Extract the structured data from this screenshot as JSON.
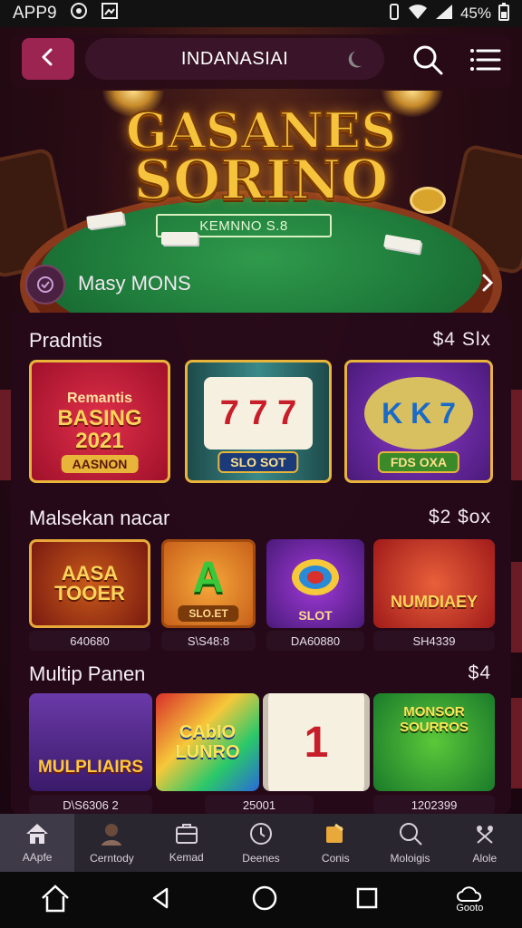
{
  "status": {
    "left_text": "APP9",
    "battery": "45%"
  },
  "header": {
    "title": "INDANASIAI"
  },
  "hero": {
    "title_line1": "GASANES",
    "title_line2": "SORINO",
    "felt_text": "KEMNNO  S.8"
  },
  "promo": {
    "text": "Masy MONS"
  },
  "sections": [
    {
      "title": "Pradntis",
      "right": "$4 Slx",
      "tiles": [
        {
          "line1": "Remantis",
          "line2": "BASING 2021",
          "label": "AASNON"
        },
        {
          "line1": "7 7 7",
          "line2": "",
          "label": "SLO SOT"
        },
        {
          "line1": "K K 7",
          "line2": "",
          "label": "FDS OXA"
        }
      ]
    },
    {
      "title": "Malsekan nacar",
      "right": "$2 $ox",
      "tiles": [
        {
          "line1": "AASA TOOER",
          "label": ""
        },
        {
          "line1": "A",
          "label": "SLO.ET"
        },
        {
          "line1": "",
          "label": "SLOT"
        },
        {
          "line1": "NUMDIAEY",
          "label": ""
        }
      ],
      "captions": [
        "640680",
        "S\\S48:8",
        "DA60880",
        "SH4339"
      ]
    },
    {
      "title": "Multip Panen",
      "right": "$4",
      "tiles": [
        {
          "line1": "MULPLIAIRS"
        },
        {
          "line1": "CAbIO LUNRO"
        },
        {
          "line1": "1"
        },
        {
          "line1": "MONSOR SOURROS"
        }
      ],
      "captions": [
        "D\\S6306 2",
        "25001",
        "1202399"
      ]
    }
  ],
  "bottom_nav": [
    {
      "label": "AApfe",
      "icon": "home-icon"
    },
    {
      "label": "Cerntody",
      "icon": "avatar-icon"
    },
    {
      "label": "Kemad",
      "icon": "briefcase-icon"
    },
    {
      "label": "Deenes",
      "icon": "clock-icon"
    },
    {
      "label": "Conis",
      "icon": "coins-icon"
    },
    {
      "label": "Moloigis",
      "icon": "search-icon"
    },
    {
      "label": "Alole",
      "icon": "tools-icon"
    }
  ],
  "sys_nav": {
    "right_label": "Gooto"
  }
}
